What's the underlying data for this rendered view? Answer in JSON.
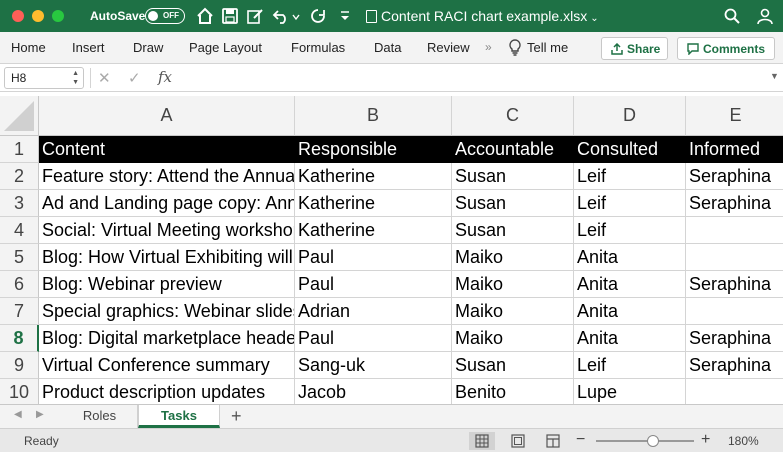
{
  "titlebar": {
    "autosave_label": "AutoSave",
    "autosave_state": "OFF",
    "doc_title": "Content RACI chart example.xlsx"
  },
  "ribbon": {
    "tabs": [
      "Home",
      "Insert",
      "Draw",
      "Page Layout",
      "Formulas",
      "Data",
      "Review"
    ],
    "overflow": "»",
    "tell_me": "Tell me",
    "share_label": "Share",
    "comments_label": "Comments"
  },
  "formula_bar": {
    "name_box": "H8",
    "cancel_glyph": "✕",
    "enter_glyph": "✓",
    "fx_label": "fx",
    "formula": ""
  },
  "grid": {
    "columns": [
      "A",
      "B",
      "C",
      "D",
      "E"
    ],
    "row_numbers": [
      "1",
      "2",
      "3",
      "4",
      "5",
      "6",
      "7",
      "8",
      "9",
      "10"
    ],
    "selected_row": "8",
    "rows": [
      [
        "Content",
        "Responsible",
        "Accountable",
        "Consulted",
        "Informed"
      ],
      [
        "Feature story: Attend the Annual Virtual Conference",
        "Katherine",
        "Susan",
        "Leif",
        "Seraphina"
      ],
      [
        "Ad and Landing page copy: Annual Virtual Conference",
        "Katherine",
        "Susan",
        "Leif",
        "Seraphina"
      ],
      [
        "Social: Virtual Meeting workshop",
        "Katherine",
        "Susan",
        "Leif",
        ""
      ],
      [
        "Blog: How Virtual Exhibiting will change",
        "Paul",
        "Maiko",
        "Anita",
        ""
      ],
      [
        "Blog: Webinar preview",
        "Paul",
        "Maiko",
        "Anita",
        "Seraphina"
      ],
      [
        "Special graphics: Webinar slides",
        "Adrian",
        "Maiko",
        "Anita",
        ""
      ],
      [
        "Blog: Digital marketplace header",
        "Paul",
        "Maiko",
        "Anita",
        "Seraphina"
      ],
      [
        "Virtual Conference summary",
        "Sang-uk",
        "Susan",
        "Leif",
        "Seraphina"
      ],
      [
        "Product description updates",
        "Jacob",
        "Benito",
        "Lupe",
        ""
      ]
    ]
  },
  "sheets": {
    "tabs": [
      "Roles",
      "Tasks"
    ],
    "active": "Tasks",
    "add_glyph": "+",
    "prev_glyph": "◀",
    "next_glyph": "▶"
  },
  "status": {
    "text": "Ready",
    "zoom_minus": "−",
    "zoom_plus": "+",
    "zoom": "180%",
    "zoom_level_fraction": 0.58
  },
  "colors": {
    "accent": "#1e7145",
    "header_fill": "#000000",
    "header_text": "#ffffff"
  },
  "icons": [
    "home-icon",
    "save-icon",
    "edit-icon",
    "undo-icon",
    "redo-icon",
    "customize-toolbar-icon",
    "search-icon",
    "account-icon",
    "lightbulb-icon",
    "share-icon",
    "comment-icon",
    "normal-view-icon",
    "page-layout-view-icon",
    "page-break-view-icon"
  ]
}
